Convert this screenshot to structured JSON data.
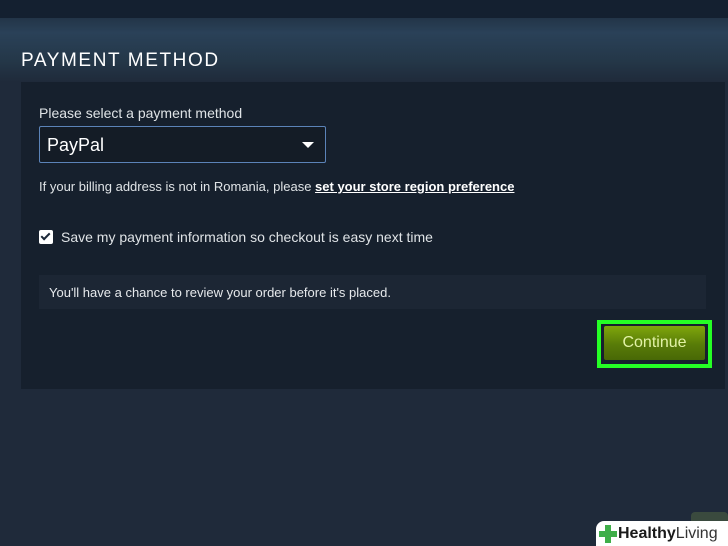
{
  "header": {
    "title": "PAYMENT METHOD"
  },
  "payment": {
    "select_label": "Please select a payment method",
    "selected_method": "PayPal",
    "region_note_prefix": "If your billing address is not in Romania, please ",
    "region_link": "set your store region preference",
    "save_info_label": "Save my payment information so checkout is easy next time",
    "save_info_checked": true,
    "review_notice": "You'll have a chance to review your order before it's placed.",
    "continue_label": "Continue"
  },
  "watermark": {
    "bold": "Healthy",
    "light": "Living",
    "icon": "cross-icon"
  },
  "colors": {
    "background": "#1f2a3a",
    "panel": "#16202d",
    "select_border": "#5b83b8",
    "continue_button": "#6a8f0a",
    "highlight": "#25ff25",
    "watermark_cross": "#3fae49"
  }
}
